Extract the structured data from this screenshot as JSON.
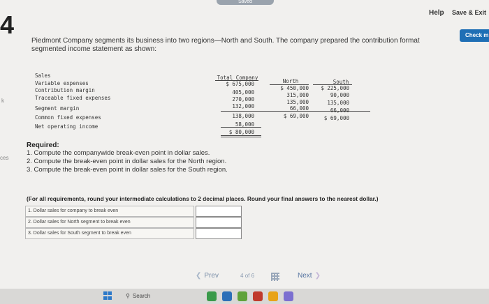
{
  "header": {
    "saved_label": "Saved",
    "help_label": "Help",
    "save_exit_label": "Save & Exit",
    "check_label": "Check m",
    "question_number": "4"
  },
  "side": {
    "frag1": "k",
    "frag2": "ces"
  },
  "intro": "Piedmont Company segments its business into two regions—North and South. The company prepared the contribution format segmented income statement as shown:",
  "statement": {
    "labels": [
      "Sales",
      "Variable expenses",
      "Contribution margin",
      "Traceable fixed expenses",
      "Segment margin",
      "Common fixed expenses",
      "Net operating income"
    ],
    "headers": {
      "total": "Total Company",
      "north": "North",
      "south": "South"
    },
    "total": [
      "$ 675,000",
      "405,000",
      "270,000",
      "132,000",
      "138,000",
      "58,000",
      "$ 80,000"
    ],
    "north": [
      "$ 450,000",
      "315,000",
      "135,000",
      "66,000",
      "$ 69,000"
    ],
    "south": [
      "$ 225,000",
      "90,000",
      "135,000",
      "66,000",
      "$ 69,000"
    ]
  },
  "required": {
    "heading": "Required:",
    "items": [
      "1. Compute the companywide break-even point in dollar sales.",
      "2. Compute the break-even point in dollar sales for the North region.",
      "3. Compute the break-even point in dollar sales for the South region."
    ],
    "note": "(For all requirements, round your intermediate calculations to 2 decimal places. Round your final answers to the nearest dollar.)"
  },
  "answers": [
    {
      "label": "1. Dollar sales for company to break even",
      "value": ""
    },
    {
      "label": "2. Dollar sales for North segment to break even",
      "value": ""
    },
    {
      "label": "3. Dollar sales for South segment to break even",
      "value": ""
    }
  ],
  "pager": {
    "prev": "Prev",
    "current": "4",
    "of": "of",
    "total": "6",
    "next": "Next"
  },
  "taskbar": {
    "search_label": "Search",
    "app_colors": [
      "#3a9a4a",
      "#2c6fb8",
      "#5fa23a",
      "#c0392b",
      "#e8a317",
      "#7b6fd0"
    ]
  }
}
